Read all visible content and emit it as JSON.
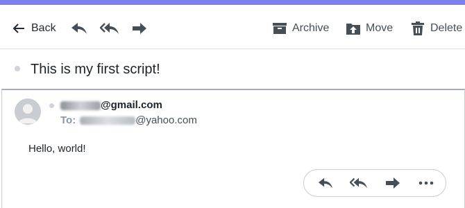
{
  "toolbar": {
    "back_label": "Back",
    "archive_label": "Archive",
    "move_label": "Move",
    "delete_label": "Delete"
  },
  "message": {
    "subject": "This is my first script!",
    "from_visible": "@gmail.com",
    "to_label": "To:",
    "to_visible": "@yahoo.com",
    "body": "Hello, world!"
  },
  "colors": {
    "accent_bar": "#7b7ff0",
    "icon": "#464e56"
  },
  "icons": [
    "arrow-left-icon",
    "reply-icon",
    "reply-all-icon",
    "forward-icon",
    "archive-icon",
    "move-icon",
    "trash-icon",
    "more-icon"
  ]
}
